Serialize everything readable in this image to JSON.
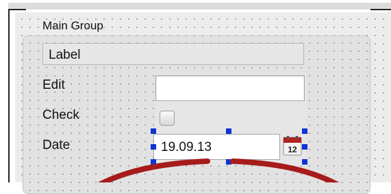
{
  "group": {
    "title": "Main Group"
  },
  "widgets": {
    "label_text": "Label",
    "edit_label": "Edit",
    "edit_value": "",
    "check_label": "Check",
    "date_label": "Date",
    "date_value": "19.09.13",
    "calendar_day": "12"
  },
  "colors": {
    "selection_handles": "#1033d6",
    "overlay_arc": "#a61b1b"
  }
}
